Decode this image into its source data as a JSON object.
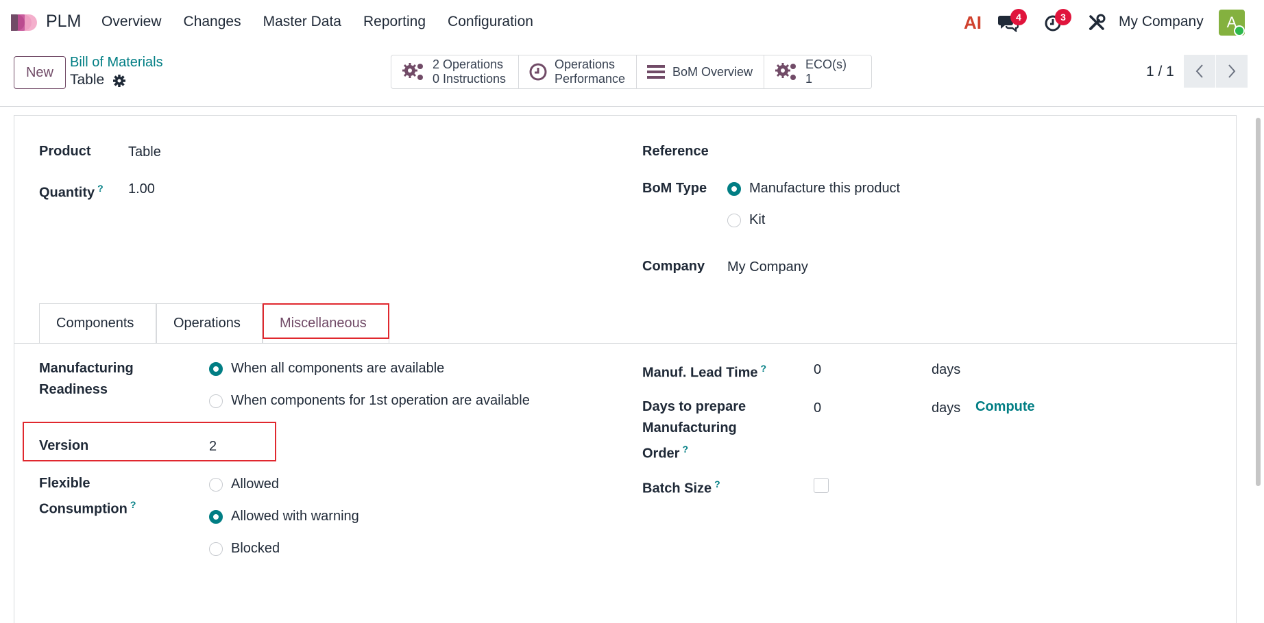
{
  "navbar": {
    "app_name": "PLM",
    "menu": [
      "Overview",
      "Changes",
      "Master Data",
      "Reporting",
      "Configuration"
    ],
    "ai_label": "AI",
    "messages_count": "4",
    "activities_count": "3",
    "company": "My Company",
    "avatar_letter": "A"
  },
  "control": {
    "new_label": "New",
    "breadcrumb": "Bill of Materials",
    "record_title": "Table",
    "smart_buttons": {
      "ops_line1": "2 Operations",
      "ops_line2": "0 Instructions",
      "perf_line1": "Operations",
      "perf_line2": "Performance",
      "bom_overview": "BoM Overview",
      "eco_line1": "ECO(s)",
      "eco_line2": "1"
    },
    "pager": "1 / 1"
  },
  "form": {
    "product_label": "Product",
    "product_value": "Table",
    "quantity_label": "Quantity",
    "quantity_value": "1.00",
    "reference_label": "Reference",
    "bom_type_label": "BoM Type",
    "bom_type_options": [
      "Manufacture this product",
      "Kit"
    ],
    "bom_type_selected": "Manufacture this product",
    "company_label": "Company",
    "company_value": "My Company"
  },
  "tabs": [
    "Components",
    "Operations",
    "Miscellaneous"
  ],
  "active_tab": "Miscellaneous",
  "misc": {
    "readiness_label_1": "Manufacturing",
    "readiness_label_2": "Readiness",
    "readiness_options": [
      "When all components are available",
      "When components for 1st operation are available"
    ],
    "readiness_selected": "When all components are available",
    "version_label": "Version",
    "version_value": "2",
    "flex_label_1": "Flexible",
    "flex_label_2": "Consumption",
    "flex_options": [
      "Allowed",
      "Allowed with warning",
      "Blocked"
    ],
    "flex_selected": "Allowed with warning",
    "lead_time_label": "Manuf. Lead Time",
    "lead_time_value": "0",
    "lead_time_unit": "days",
    "prepare_label_1": "Days to prepare",
    "prepare_label_2": "Manufacturing",
    "prepare_label_3": "Order",
    "prepare_value": "0",
    "prepare_unit": "days",
    "compute_label": "Compute",
    "batch_label": "Batch Size",
    "help_mark": "?"
  },
  "colors": {
    "accent": "#017e84",
    "brand": "#714b67",
    "badge": "#e0143c",
    "highlight": "#e0282e"
  }
}
